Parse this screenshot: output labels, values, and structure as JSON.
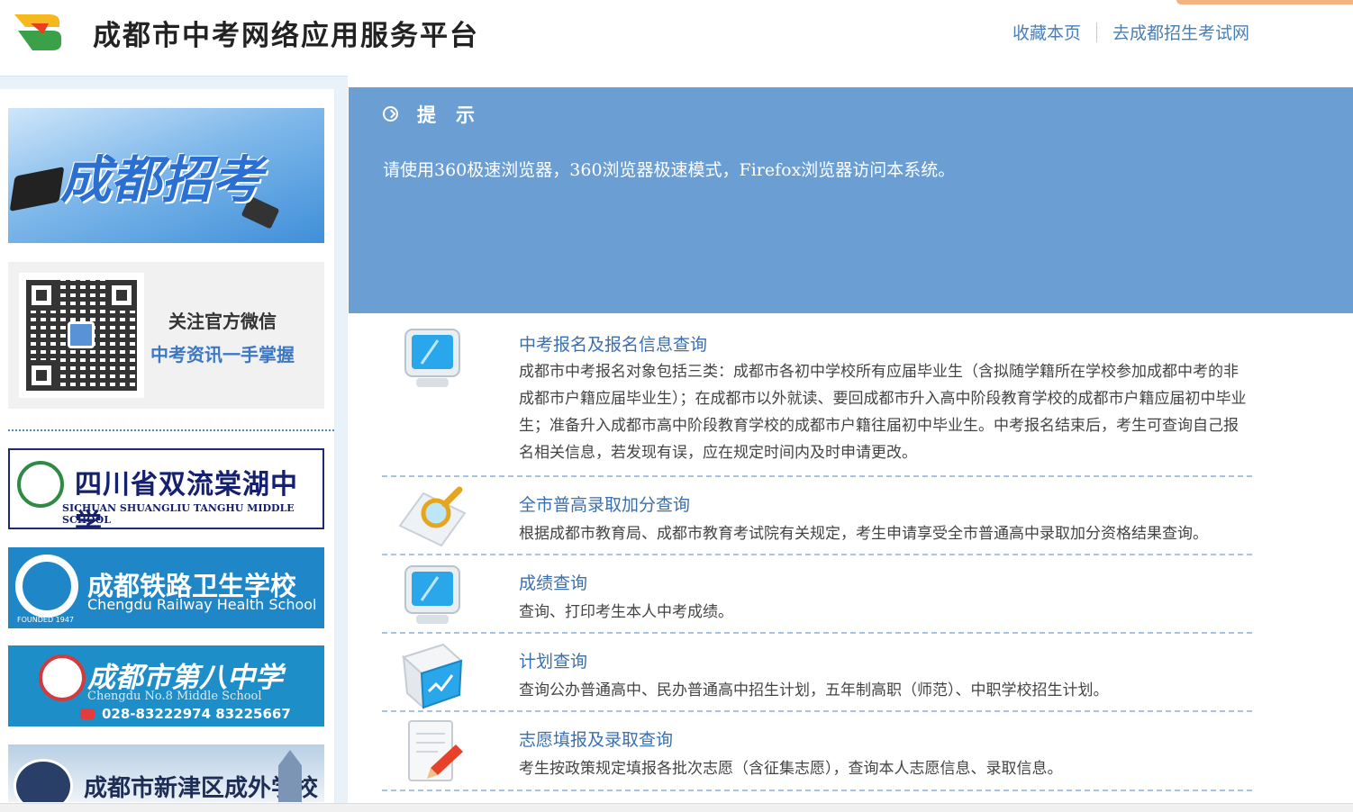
{
  "header": {
    "title": "成都市中考网络应用服务平台",
    "links": [
      "收藏本页",
      "去成都招生考试网"
    ]
  },
  "sidebar": {
    "banner_text": "成都招考",
    "wechat": {
      "line1": "关注官方微信",
      "line2": "中考资讯一手掌握"
    },
    "schools": [
      {
        "cn": "四川省双流棠湖中学",
        "en": "SICHUAN SHUANGLIU TANGHU MIDDLE SCHOOL"
      },
      {
        "cn": "成都铁路卫生学校",
        "en": "Chengdu Railway Health School",
        "extra": "FOUNDED 1947"
      },
      {
        "cn": "成都市第八中学",
        "en": "Chengdu No.8 Middle School",
        "phone": "028-83222974  83225667"
      },
      {
        "cn": "成都市新津区成外学校"
      }
    ]
  },
  "notice": {
    "title": "提示",
    "message": "请使用360极速浏览器，360浏览器极速模式，Firefox浏览器访问本系统。"
  },
  "items": [
    {
      "title": "中考报名及报名信息查询",
      "desc": "成都市中考报名对象包括三类：成都市各初中学校所有应届毕业生（含拟随学籍所在学校参加成都中考的非成都市户籍应届毕业生）；在成都市以外就读、要回成都市升入高中阶段教育学校的成都市户籍应届初中毕业生；准备升入成都市高中阶段教育学校的成都市户籍往届初中毕业生。中考报名结束后，考生可查询自己报名相关信息，若发现有误，应在规定时间内及时申请更改。",
      "icon": "monitor-icon"
    },
    {
      "title": "全市普高录取加分查询",
      "desc": "根据成都市教育局、成都市教育考试院有关规定，考生申请享受全市普通高中录取加分资格结果查询。",
      "icon": "magnifier-icon"
    },
    {
      "title": "成绩查询",
      "desc": "查询、打印考生本人中考成绩。",
      "icon": "monitor-icon"
    },
    {
      "title": "计划查询",
      "desc": "查询公办普通高中、民办普通高中招生计划，五年制高职（师范）、中职学校招生计划。",
      "icon": "chart-box-icon"
    },
    {
      "title": "志愿填报及录取查询",
      "desc": "考生按政策规定填报各批次志愿（含征集志愿），查询本人志愿信息、录取信息。",
      "icon": "document-pen-icon"
    }
  ],
  "colors": {
    "accent": "#6b9fd3",
    "link": "#3a6fb0",
    "divider": "#a9c4e0"
  }
}
